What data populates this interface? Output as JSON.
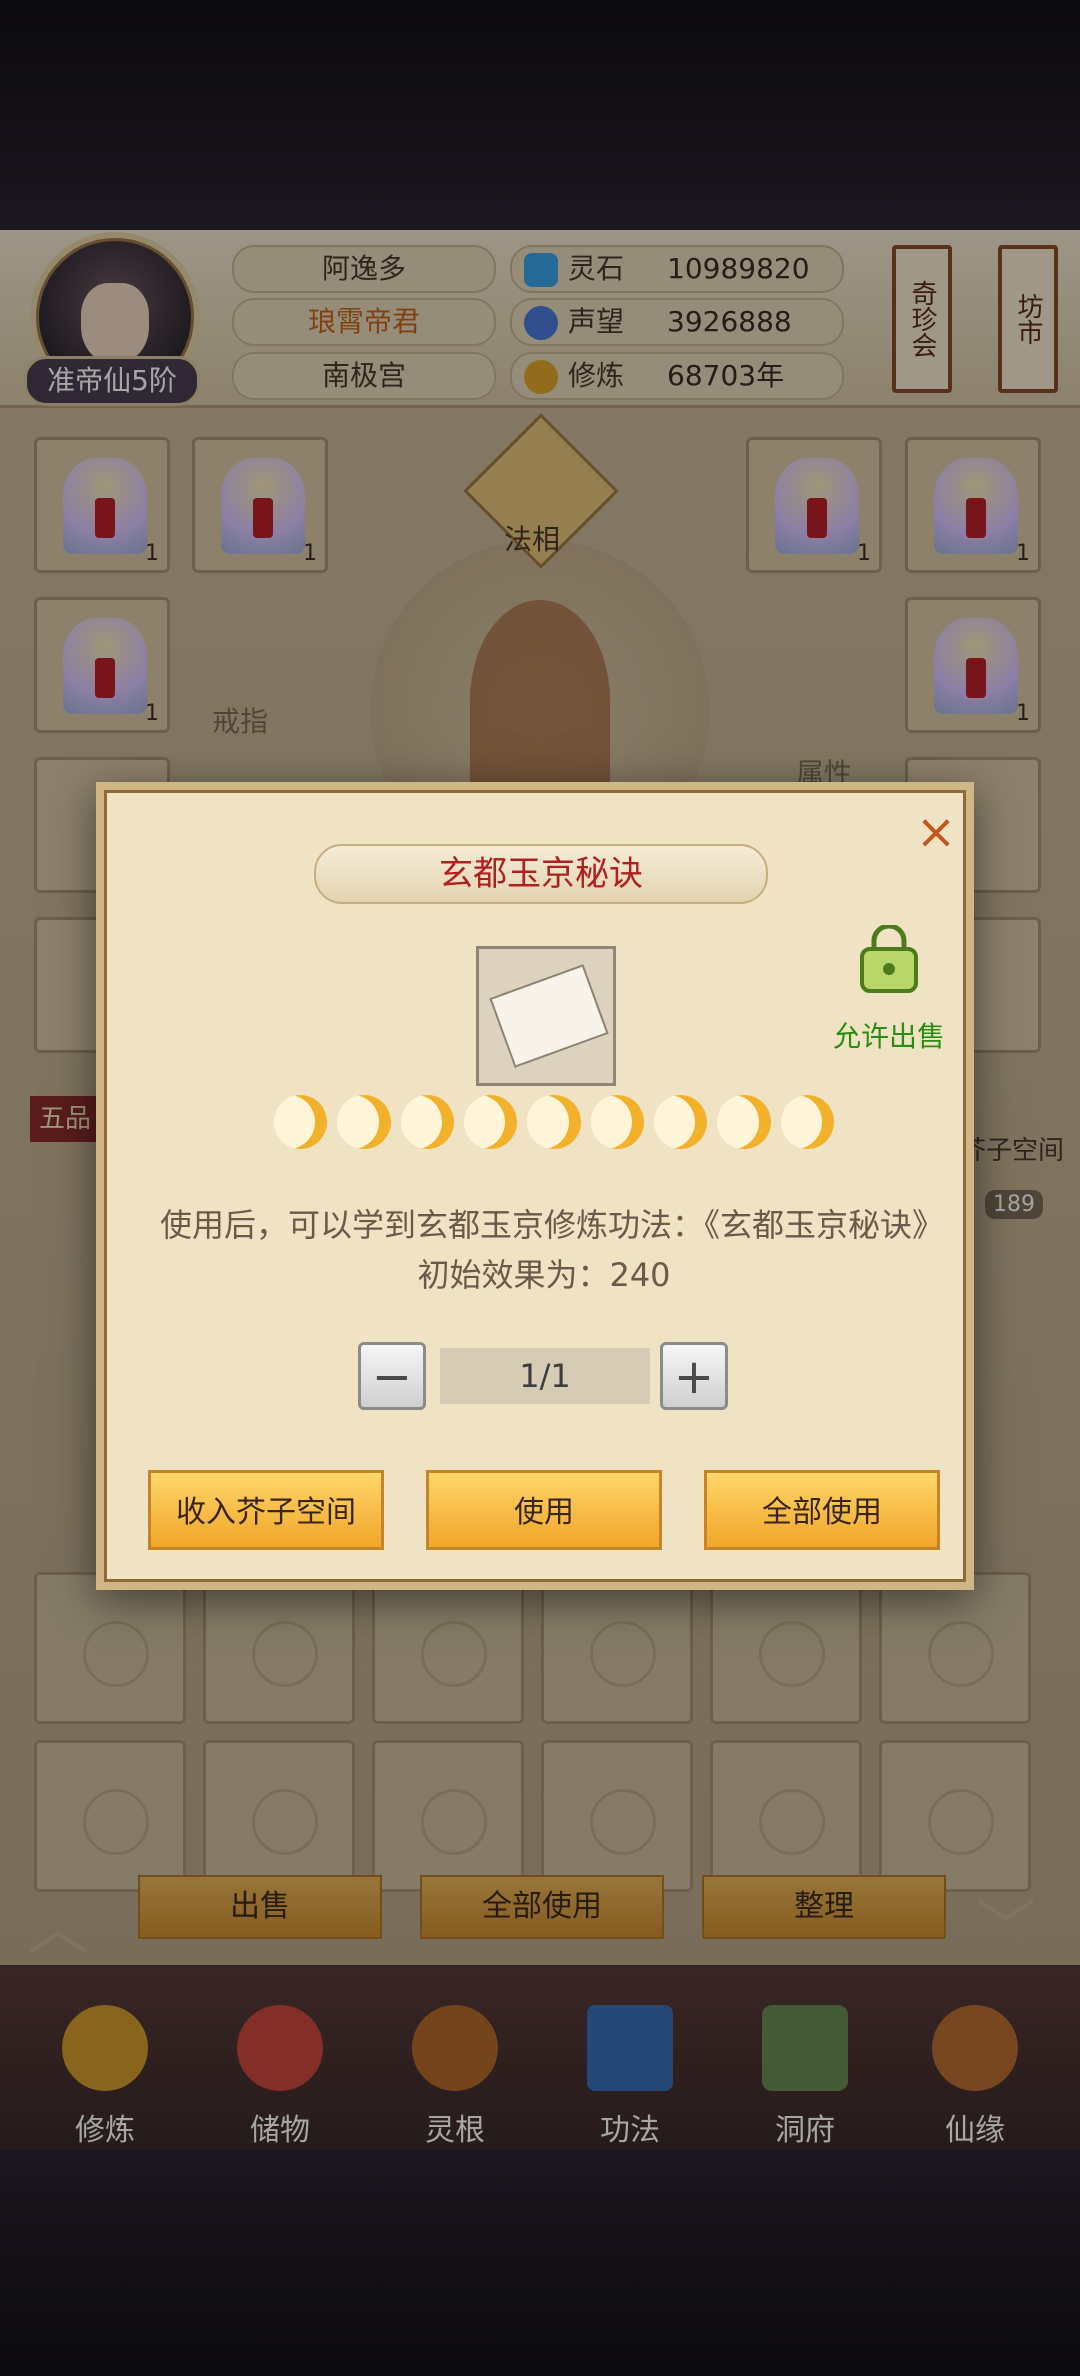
{
  "player": {
    "name": "阿逸多",
    "title": "琅霄帝君",
    "sect": "南极宫",
    "rank": "准帝仙5阶"
  },
  "resources": [
    {
      "label": "灵石",
      "value": "10989820",
      "icon": "spirit-stone-icon",
      "color": "#3aa2e6"
    },
    {
      "label": "声望",
      "value": "3926888",
      "icon": "reputation-icon",
      "color": "#4a7ad8"
    },
    {
      "label": "修炼",
      "value": "68703年",
      "icon": "meditation-icon",
      "color": "#e1a52c"
    }
  ],
  "side_buttons": {
    "curio": "奇珍会",
    "market": "坊市"
  },
  "equipment": {
    "fa_xiang": "法相",
    "ring": "戒指",
    "attribute": "属性",
    "grade_tab": "五品",
    "mustard_space": "芥子空间",
    "capacity": "189",
    "slot_counts": [
      "1",
      "1",
      "1",
      "1",
      "1",
      "1"
    ]
  },
  "dialog": {
    "title": "玄都玉京秘诀",
    "close": "×",
    "allow_sale": "允许出售",
    "moons_count": 9,
    "description": "使用后，可以学到玄都玉京修炼功法：《玄都玉京秘诀》初始效果为：240",
    "quantity": "1/1",
    "minus": "−",
    "plus": "+",
    "btn_store": "收入芥子空间",
    "btn_use": "使用",
    "btn_use_all": "全部使用"
  },
  "bag_actions": {
    "sell": "出售",
    "use_all": "全部使用",
    "sort": "整理"
  },
  "nav": [
    {
      "label": "修炼",
      "icon": "cultivate-icon",
      "color": "#d39a2b"
    },
    {
      "label": "储物",
      "icon": "storage-bag-icon",
      "color": "#c9473f"
    },
    {
      "label": "灵根",
      "icon": "spirit-root-icon",
      "color": "#b36a2c"
    },
    {
      "label": "功法",
      "icon": "technique-book-icon",
      "color": "#3a6fb6"
    },
    {
      "label": "洞府",
      "icon": "cave-dwelling-icon",
      "color": "#6b8a55"
    },
    {
      "label": "仙缘",
      "icon": "immortal-fate-icon",
      "color": "#b86d35"
    }
  ]
}
